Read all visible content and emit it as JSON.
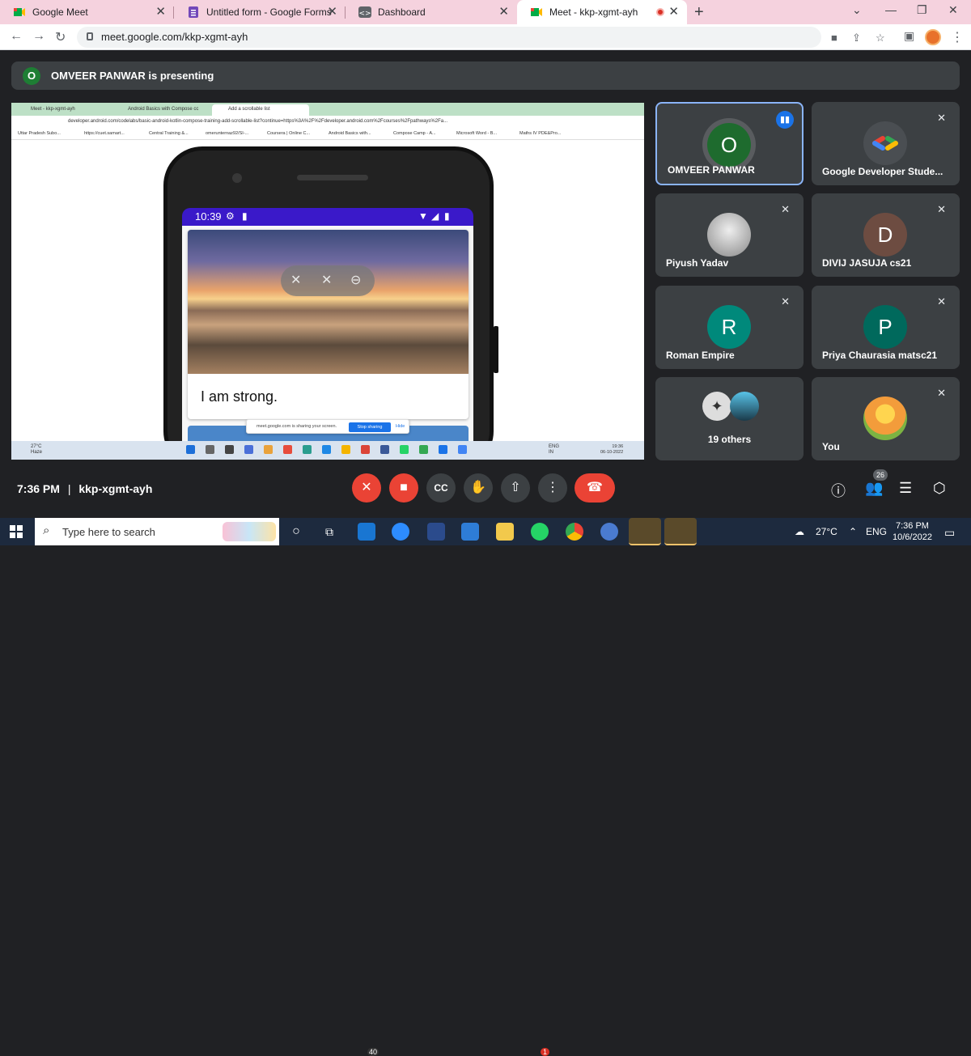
{
  "browser": {
    "tabs": [
      {
        "title": "Google Meet"
      },
      {
        "title": "Untitled form - Google Forms"
      },
      {
        "title": "Dashboard"
      },
      {
        "title": "Meet - kkp-xgmt-ayh"
      }
    ],
    "url": "meet.google.com/kkp-xgmt-ayh"
  },
  "presenting": {
    "avatar_letter": "O",
    "text": "OMVEER PANWAR is presenting"
  },
  "shared_screen": {
    "tabs": [
      "Meet - kkp-xgmt-ayh",
      "Android Basics with Compose cc",
      "Add a scrollable list"
    ],
    "url": "developer.android.com/codelabs/basic-android-kotlin-compose-training-add-scrollable-list?continue=https%3A%2F%2Fdeveloper.android.com%2Fcourses%2Fpathways%2Fa...",
    "bookmarks": [
      "Uttar Pradesh Subo...",
      "https://cuet.samart...",
      "Central Training &...",
      "omerunternaz92/SI-...",
      "Coursera | Online C...",
      "Android Basics with...",
      "Compose Camp - A...",
      "Microsoft Word - B...",
      "Maths IV PDE&Pro..."
    ],
    "phone_time": "10:39",
    "card_caption": "I am strong.",
    "share_text": "meet.google.com is sharing your screen.",
    "stop_label": "Stop sharing",
    "hide_label": "Hide",
    "weather": "27°C",
    "weather_desc": "Haze",
    "tray_lang": "ENG",
    "tray_region": "IN",
    "clock_time": "19:36",
    "clock_date": "06-10-2022"
  },
  "participants": [
    {
      "name": "OMVEER PANWAR",
      "initial": "O",
      "color": "#1e6b2e",
      "speaking": true
    },
    {
      "name": "Google Developer Stude...",
      "initial": "",
      "color": "#ffffff",
      "speaking": false
    },
    {
      "name": "Piyush Yadav",
      "initial": "",
      "color": "#bbbbbb",
      "speaking": false
    },
    {
      "name": "DIVIJ JASUJA cs21",
      "initial": "D",
      "color": "#6d4c41",
      "speaking": false
    },
    {
      "name": "Roman Empire",
      "initial": "R",
      "color": "#00897b",
      "speaking": false
    },
    {
      "name": "Priya Chaurasia matsc21",
      "initial": "P",
      "color": "#00695c",
      "speaking": false
    },
    {
      "name": "19 others",
      "initial": "",
      "color": "#555555",
      "speaking": false
    },
    {
      "name": "You",
      "initial": "",
      "color": "#f39c3b",
      "speaking": false
    }
  ],
  "meeting": {
    "time": "7:36 PM",
    "divider": "|",
    "code": "kkp-xgmt-ayh",
    "people_count": "26"
  },
  "taskbar": {
    "search_placeholder": "Type here to search",
    "mail_badge": "40",
    "whatsapp_badge": "1",
    "temperature": "27°C",
    "lang": "ENG",
    "time": "7:36 PM",
    "date": "10/6/2022"
  }
}
